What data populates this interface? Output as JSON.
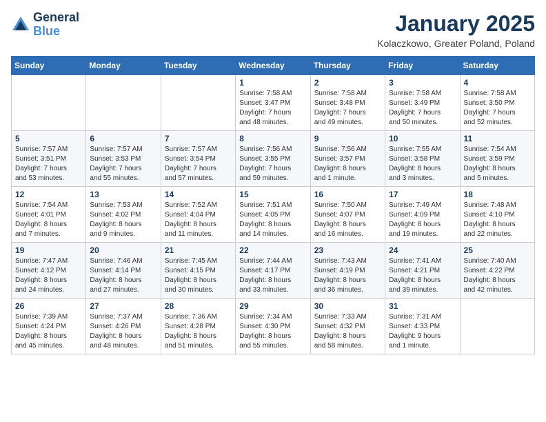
{
  "header": {
    "logo_line1": "General",
    "logo_line2": "Blue",
    "title": "January 2025",
    "subtitle": "Kolaczkowo, Greater Poland, Poland"
  },
  "days_of_week": [
    "Sunday",
    "Monday",
    "Tuesday",
    "Wednesday",
    "Thursday",
    "Friday",
    "Saturday"
  ],
  "weeks": [
    [
      {
        "day": "",
        "info": ""
      },
      {
        "day": "",
        "info": ""
      },
      {
        "day": "",
        "info": ""
      },
      {
        "day": "1",
        "info": "Sunrise: 7:58 AM\nSunset: 3:47 PM\nDaylight: 7 hours\nand 48 minutes."
      },
      {
        "day": "2",
        "info": "Sunrise: 7:58 AM\nSunset: 3:48 PM\nDaylight: 7 hours\nand 49 minutes."
      },
      {
        "day": "3",
        "info": "Sunrise: 7:58 AM\nSunset: 3:49 PM\nDaylight: 7 hours\nand 50 minutes."
      },
      {
        "day": "4",
        "info": "Sunrise: 7:58 AM\nSunset: 3:50 PM\nDaylight: 7 hours\nand 52 minutes."
      }
    ],
    [
      {
        "day": "5",
        "info": "Sunrise: 7:57 AM\nSunset: 3:51 PM\nDaylight: 7 hours\nand 53 minutes."
      },
      {
        "day": "6",
        "info": "Sunrise: 7:57 AM\nSunset: 3:53 PM\nDaylight: 7 hours\nand 55 minutes."
      },
      {
        "day": "7",
        "info": "Sunrise: 7:57 AM\nSunset: 3:54 PM\nDaylight: 7 hours\nand 57 minutes."
      },
      {
        "day": "8",
        "info": "Sunrise: 7:56 AM\nSunset: 3:55 PM\nDaylight: 7 hours\nand 59 minutes."
      },
      {
        "day": "9",
        "info": "Sunrise: 7:56 AM\nSunset: 3:57 PM\nDaylight: 8 hours\nand 1 minute."
      },
      {
        "day": "10",
        "info": "Sunrise: 7:55 AM\nSunset: 3:58 PM\nDaylight: 8 hours\nand 3 minutes."
      },
      {
        "day": "11",
        "info": "Sunrise: 7:54 AM\nSunset: 3:59 PM\nDaylight: 8 hours\nand 5 minutes."
      }
    ],
    [
      {
        "day": "12",
        "info": "Sunrise: 7:54 AM\nSunset: 4:01 PM\nDaylight: 8 hours\nand 7 minutes."
      },
      {
        "day": "13",
        "info": "Sunrise: 7:53 AM\nSunset: 4:02 PM\nDaylight: 8 hours\nand 9 minutes."
      },
      {
        "day": "14",
        "info": "Sunrise: 7:52 AM\nSunset: 4:04 PM\nDaylight: 8 hours\nand 11 minutes."
      },
      {
        "day": "15",
        "info": "Sunrise: 7:51 AM\nSunset: 4:05 PM\nDaylight: 8 hours\nand 14 minutes."
      },
      {
        "day": "16",
        "info": "Sunrise: 7:50 AM\nSunset: 4:07 PM\nDaylight: 8 hours\nand 16 minutes."
      },
      {
        "day": "17",
        "info": "Sunrise: 7:49 AM\nSunset: 4:09 PM\nDaylight: 8 hours\nand 19 minutes."
      },
      {
        "day": "18",
        "info": "Sunrise: 7:48 AM\nSunset: 4:10 PM\nDaylight: 8 hours\nand 22 minutes."
      }
    ],
    [
      {
        "day": "19",
        "info": "Sunrise: 7:47 AM\nSunset: 4:12 PM\nDaylight: 8 hours\nand 24 minutes."
      },
      {
        "day": "20",
        "info": "Sunrise: 7:46 AM\nSunset: 4:14 PM\nDaylight: 8 hours\nand 27 minutes."
      },
      {
        "day": "21",
        "info": "Sunrise: 7:45 AM\nSunset: 4:15 PM\nDaylight: 8 hours\nand 30 minutes."
      },
      {
        "day": "22",
        "info": "Sunrise: 7:44 AM\nSunset: 4:17 PM\nDaylight: 8 hours\nand 33 minutes."
      },
      {
        "day": "23",
        "info": "Sunrise: 7:43 AM\nSunset: 4:19 PM\nDaylight: 8 hours\nand 36 minutes."
      },
      {
        "day": "24",
        "info": "Sunrise: 7:41 AM\nSunset: 4:21 PM\nDaylight: 8 hours\nand 39 minutes."
      },
      {
        "day": "25",
        "info": "Sunrise: 7:40 AM\nSunset: 4:22 PM\nDaylight: 8 hours\nand 42 minutes."
      }
    ],
    [
      {
        "day": "26",
        "info": "Sunrise: 7:39 AM\nSunset: 4:24 PM\nDaylight: 8 hours\nand 45 minutes."
      },
      {
        "day": "27",
        "info": "Sunrise: 7:37 AM\nSunset: 4:26 PM\nDaylight: 8 hours\nand 48 minutes."
      },
      {
        "day": "28",
        "info": "Sunrise: 7:36 AM\nSunset: 4:28 PM\nDaylight: 8 hours\nand 51 minutes."
      },
      {
        "day": "29",
        "info": "Sunrise: 7:34 AM\nSunset: 4:30 PM\nDaylight: 8 hours\nand 55 minutes."
      },
      {
        "day": "30",
        "info": "Sunrise: 7:33 AM\nSunset: 4:32 PM\nDaylight: 8 hours\nand 58 minutes."
      },
      {
        "day": "31",
        "info": "Sunrise: 7:31 AM\nSunset: 4:33 PM\nDaylight: 9 hours\nand 1 minute."
      },
      {
        "day": "",
        "info": ""
      }
    ]
  ]
}
